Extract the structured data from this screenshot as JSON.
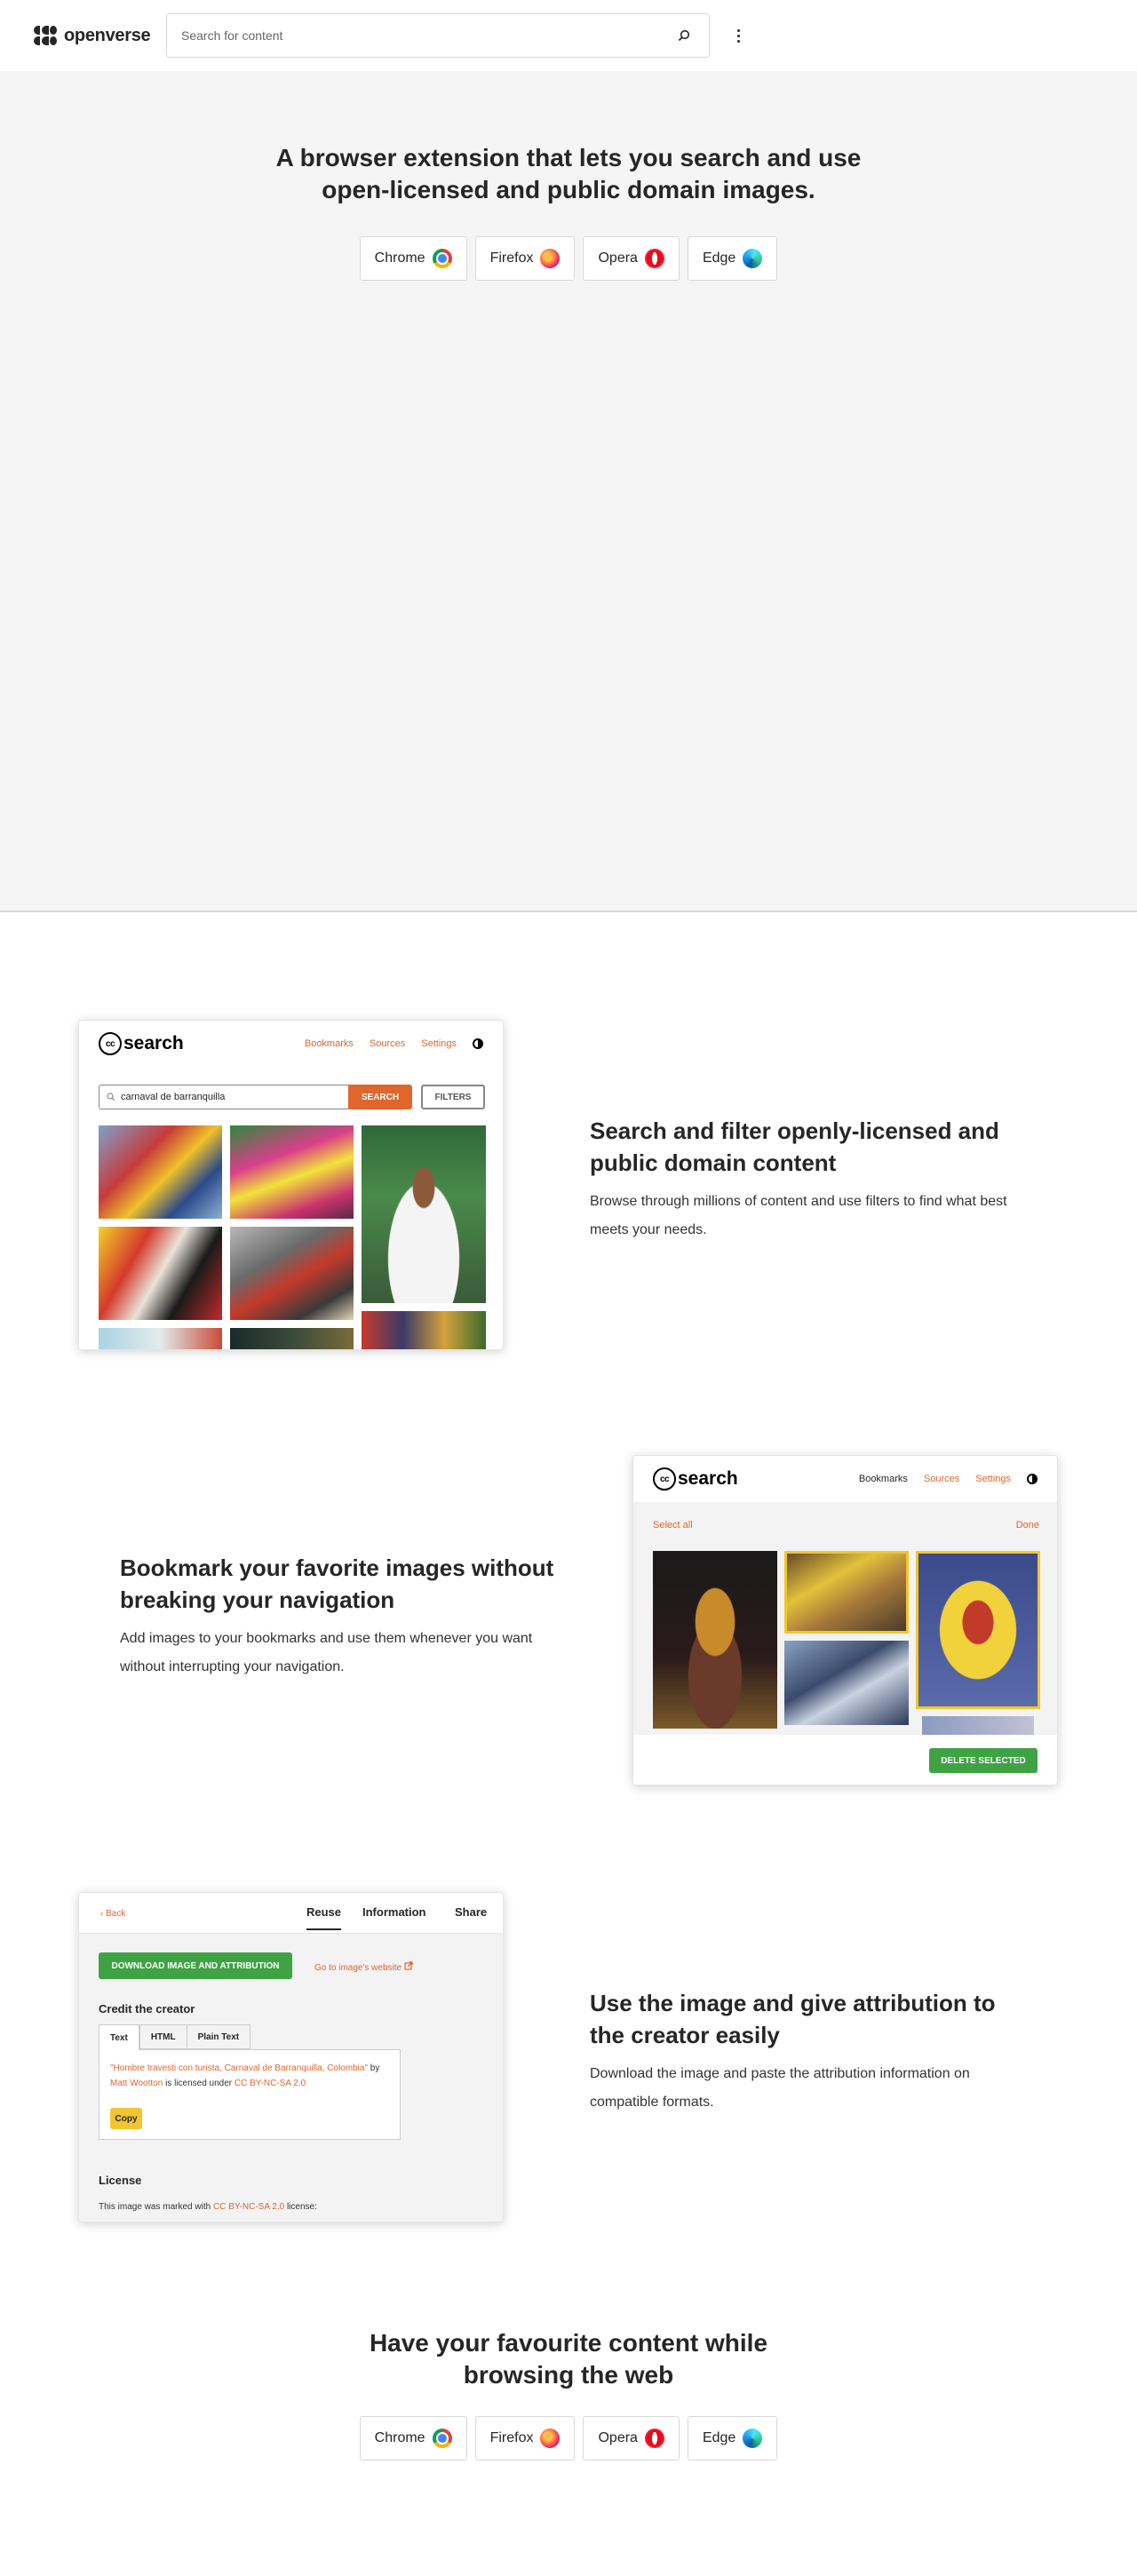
{
  "header": {
    "brand": "openverse",
    "search_placeholder": "Search for content"
  },
  "hero": {
    "title": "A browser extension that lets you search and use open-licensed and public domain images.",
    "browsers": [
      "Chrome",
      "Firefox",
      "Opera",
      "Edge"
    ]
  },
  "feature1": {
    "title": "Search and filter openly-licensed and public domain content",
    "body": "Browse through millions of content and use filters to find what best meets your needs.",
    "mock": {
      "logo": "search",
      "cc": "cc",
      "nav": [
        "Bookmarks",
        "Sources",
        "Settings"
      ],
      "query": "carnaval de barranquilla",
      "search_button": "SEARCH",
      "filters_button": "FILTERS"
    }
  },
  "feature2": {
    "title": "Bookmark your favorite images without breaking your navigation",
    "body": "Add images to your bookmarks and use them whenever you want without interrupting your navigation.",
    "mock": {
      "logo": "search",
      "cc": "cc",
      "nav": [
        "Bookmarks",
        "Sources",
        "Settings"
      ],
      "select_all": "Select all",
      "done": "Done",
      "delete_button": "DELETE SELECTED"
    }
  },
  "feature3": {
    "title": "Use the image and give attribution to the creator easily",
    "body": "Download the image and paste the attribution information on compatible formats.",
    "mock": {
      "back": "Back",
      "tabs": [
        "Reuse",
        "Information",
        "Share"
      ],
      "download_button": "DOWNLOAD IMAGE AND ATTRIBUTION",
      "go_to_site": "Go to image's website",
      "credit_heading": "Credit the creator",
      "format_tabs": [
        "Text",
        "HTML",
        "Plain Text"
      ],
      "attribution": {
        "title": "\"Hombre travesti con turista, Carnaval de Barranquilla, Colombia\"",
        "by": "by",
        "author": "Matt Wootton",
        "licensed": "is licensed under",
        "license": "CC BY-NC-SA 2.0"
      },
      "copy_button": "Copy",
      "license_heading": "License",
      "license_text": "This image was marked with",
      "license_link": "CC BY-NC-SA 2.0",
      "license_suffix": "license:"
    }
  },
  "bottom": {
    "title": "Have your favourite content while browsing the web",
    "browsers": [
      "Chrome",
      "Firefox",
      "Opera",
      "Edge"
    ]
  },
  "colors": {
    "accent": "#e0662d",
    "green": "#3fa243",
    "yellow": "#f1c62e",
    "hero_bg": "#f5f5f5"
  }
}
